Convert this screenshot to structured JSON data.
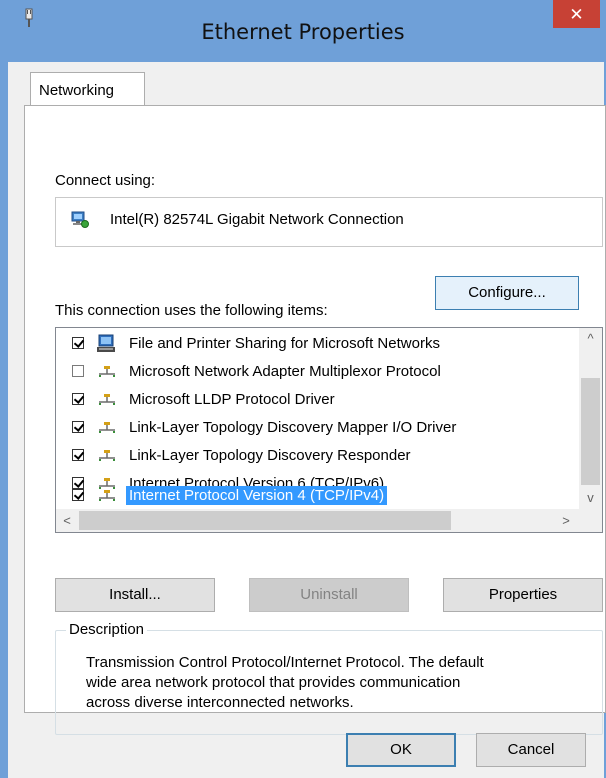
{
  "window": {
    "title": "Ethernet Properties",
    "close_glyph": "✕",
    "accent_color": "#6fa0d8",
    "close_color": "#c74135"
  },
  "tabs": [
    {
      "label": "Networking",
      "active": true
    }
  ],
  "connect_using": {
    "label": "Connect using:",
    "adapter_name": "Intel(R) 82574L Gigabit Network Connection",
    "adapter_icon": "network-adapter-icon"
  },
  "buttons": {
    "configure": "Configure...",
    "install": "Install...",
    "uninstall": "Uninstall",
    "properties": "Properties",
    "ok": "OK",
    "cancel": "Cancel"
  },
  "items_label": "This connection uses the following items:",
  "items": [
    {
      "label": "File and Printer Sharing for Microsoft Networks",
      "checked": true,
      "icon": "network-service-icon",
      "selected": false
    },
    {
      "label": "Microsoft Network Adapter Multiplexor Protocol",
      "checked": false,
      "icon": "protocol-icon",
      "selected": false
    },
    {
      "label": "Microsoft LLDP Protocol Driver",
      "checked": true,
      "icon": "protocol-icon",
      "selected": false
    },
    {
      "label": "Link-Layer Topology Discovery Mapper I/O Driver",
      "checked": true,
      "icon": "protocol-icon",
      "selected": false
    },
    {
      "label": "Link-Layer Topology Discovery Responder",
      "checked": true,
      "icon": "protocol-icon",
      "selected": false
    },
    {
      "label": "Internet Protocol Version 6 (TCP/IPv6)",
      "checked": true,
      "icon": "protocol-icon",
      "selected": false
    },
    {
      "label": "Internet Protocol Version 4 (TCP/IPv4)",
      "checked": true,
      "icon": "protocol-icon",
      "selected": true
    }
  ],
  "scroll": {
    "up": "^",
    "down": "v",
    "left": "<",
    "right": ">"
  },
  "description": {
    "legend": "Description",
    "lines": [
      "Transmission Control Protocol/Internet Protocol. The default",
      "wide area network protocol that provides communication",
      "across diverse interconnected networks."
    ]
  }
}
